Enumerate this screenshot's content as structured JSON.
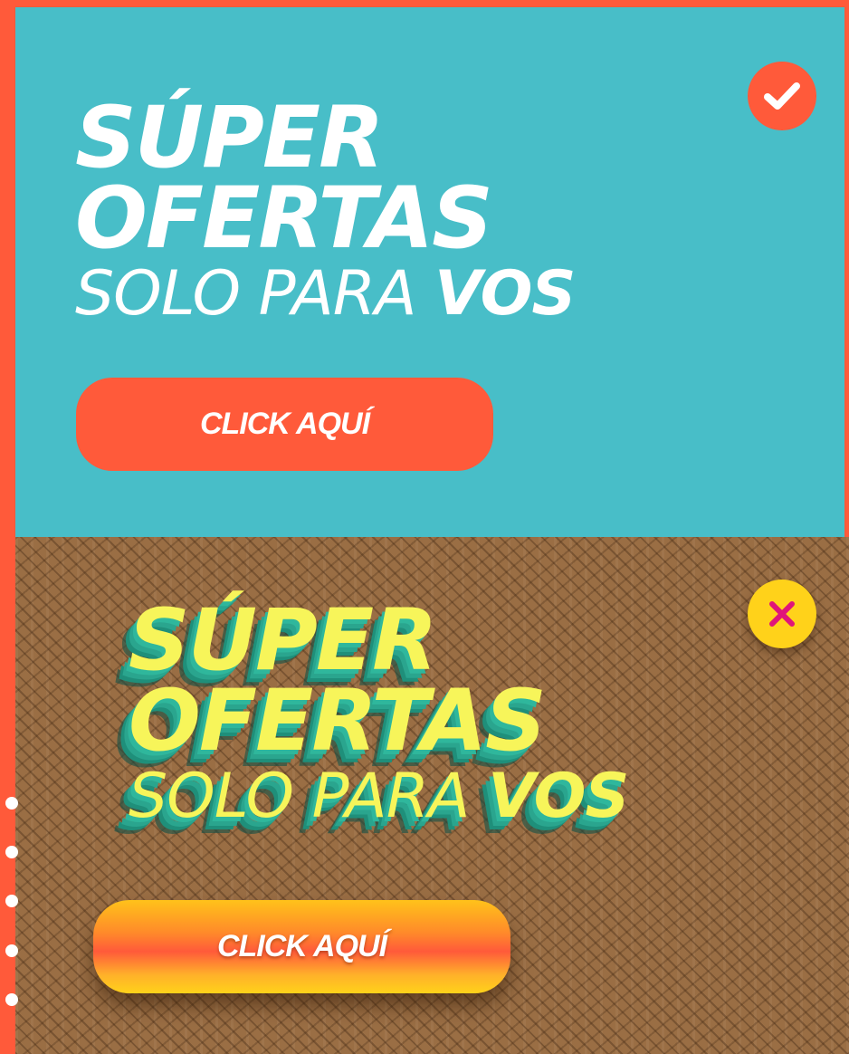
{
  "good_example": {
    "headline_line1": "SÚPER",
    "headline_line2": "OFERTAS",
    "headline_line3_light": "SOLO PARA ",
    "headline_line3_bold": "VOS",
    "button_label": "CLICK AQUÍ",
    "badge_icon": "check-icon",
    "background_color": "#48bec8",
    "accent_color": "#ff5a3a"
  },
  "bad_example": {
    "headline_line1": "SÚPER",
    "headline_line2": "OFERTAS",
    "headline_line3_light": "SOLO PARA ",
    "headline_line3_bold": "VOS",
    "button_label": "CLICK AQUÍ",
    "badge_icon": "close-icon",
    "background_color": "#9a6e44",
    "text_color": "#f7f55a",
    "badge_color": "#ffd21a",
    "cross_color": "#e0147a"
  }
}
